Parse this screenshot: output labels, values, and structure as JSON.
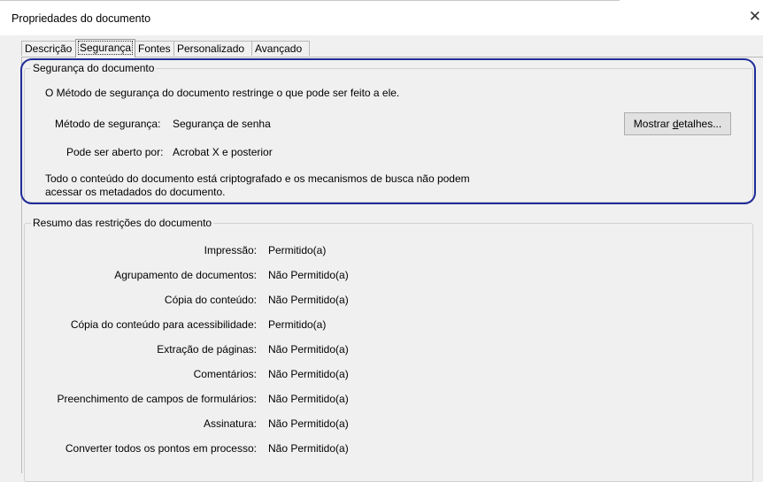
{
  "dialog": {
    "title": "Propriedades do documento",
    "close_glyph": "✕"
  },
  "tabs": [
    {
      "label": "Descrição",
      "active": false
    },
    {
      "label": "Segurança",
      "active": true
    },
    {
      "label": "Fontes",
      "active": false
    },
    {
      "label": "Personalizado",
      "active": false
    },
    {
      "label": "Avançado",
      "active": false
    }
  ],
  "security": {
    "group_title": "Segurança do documento",
    "intro": "O Método de segurança do documento restringe o que pode ser feito a ele.",
    "method_label": "Método de segurança:",
    "method_value": "Segurança de senha",
    "opened_label": "Pode ser aberto por:",
    "opened_value": "Acrobat X e posterior",
    "encryption_line1": "Todo o conteúdo do documento está criptografado e os mecanismos de busca não podem",
    "encryption_line2": "acessar os metadados do documento.",
    "details_button": {
      "prefix": "Mostrar ",
      "accel": "d",
      "suffix": "etalhes..."
    },
    "highlight_color": "#1f2c98"
  },
  "restrictions": {
    "group_title": "Resumo das restrições do documento",
    "rows": [
      {
        "label": "Impressão:",
        "value": "Permitido(a)"
      },
      {
        "label": "Agrupamento de documentos:",
        "value": "Não Permitido(a)"
      },
      {
        "label": "Cópia do conteúdo:",
        "value": "Não Permitido(a)"
      },
      {
        "label": "Cópia do conteúdo para acessibilidade:",
        "value": "Permitido(a)"
      },
      {
        "label": "Extração de páginas:",
        "value": "Não Permitido(a)"
      },
      {
        "label": "Comentários:",
        "value": "Não Permitido(a)"
      },
      {
        "label": "Preenchimento de campos de formulários:",
        "value": "Não Permitido(a)"
      },
      {
        "label": "Assinatura:",
        "value": "Não Permitido(a)"
      },
      {
        "label": "Converter todos os pontos em processo:",
        "value": "Não Permitido(a)"
      }
    ]
  }
}
